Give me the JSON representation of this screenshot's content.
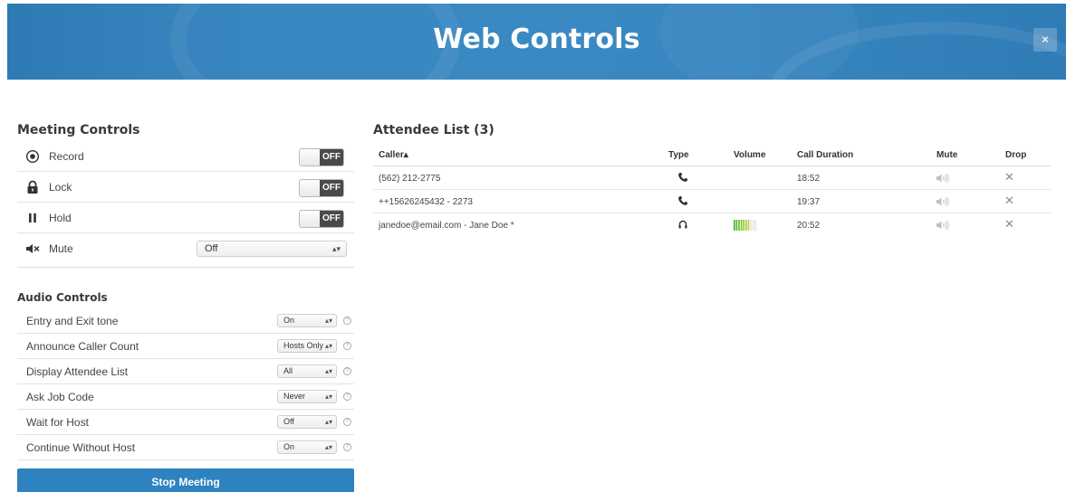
{
  "header": {
    "title": "Web Controls",
    "close_label": "×"
  },
  "meeting_controls": {
    "title": "Meeting Controls",
    "items": [
      {
        "label": "Record",
        "icon": "record-icon",
        "control": "toggle",
        "value": "OFF"
      },
      {
        "label": "Lock",
        "icon": "lock-icon",
        "control": "toggle",
        "value": "OFF"
      },
      {
        "label": "Hold",
        "icon": "pause-icon",
        "control": "toggle",
        "value": "OFF"
      },
      {
        "label": "Mute",
        "icon": "speaker-mute-icon",
        "control": "select",
        "value": "Off"
      }
    ]
  },
  "audio_controls": {
    "title": "Audio Controls",
    "items": [
      {
        "label": "Entry and Exit tone",
        "value": "On"
      },
      {
        "label": "Announce Caller Count",
        "value": "Hosts Only"
      },
      {
        "label": "Display Attendee List",
        "value": "All"
      },
      {
        "label": "Ask Job Code",
        "value": "Never"
      },
      {
        "label": "Wait for Host",
        "value": "Off"
      },
      {
        "label": "Continue Without Host",
        "value": "On"
      }
    ],
    "help_glyph": "?"
  },
  "stop_button": {
    "label": "Stop Meeting"
  },
  "attendee_list": {
    "title": "Attendee List (3)",
    "columns": [
      "Caller▴",
      "Type",
      "Volume",
      "Call Duration",
      "Mute",
      "Drop"
    ],
    "rows": [
      {
        "caller": "(562) 212-2775",
        "type": "phone-icon",
        "volume_level": null,
        "duration": "18:52"
      },
      {
        "caller": "++15626245432 - 2273",
        "type": "phone-icon",
        "volume_level": null,
        "duration": "19:37"
      },
      {
        "caller": "janedoe@email.com - Jane Doe *",
        "type": "headset-icon",
        "volume_level": 0.7,
        "duration": "20:52"
      }
    ],
    "drop_glyph": "✕"
  },
  "colors": {
    "header_blue": "#3a88c2",
    "button_blue": "#2d82bf",
    "toggle_dark": "#4a4a4a"
  }
}
